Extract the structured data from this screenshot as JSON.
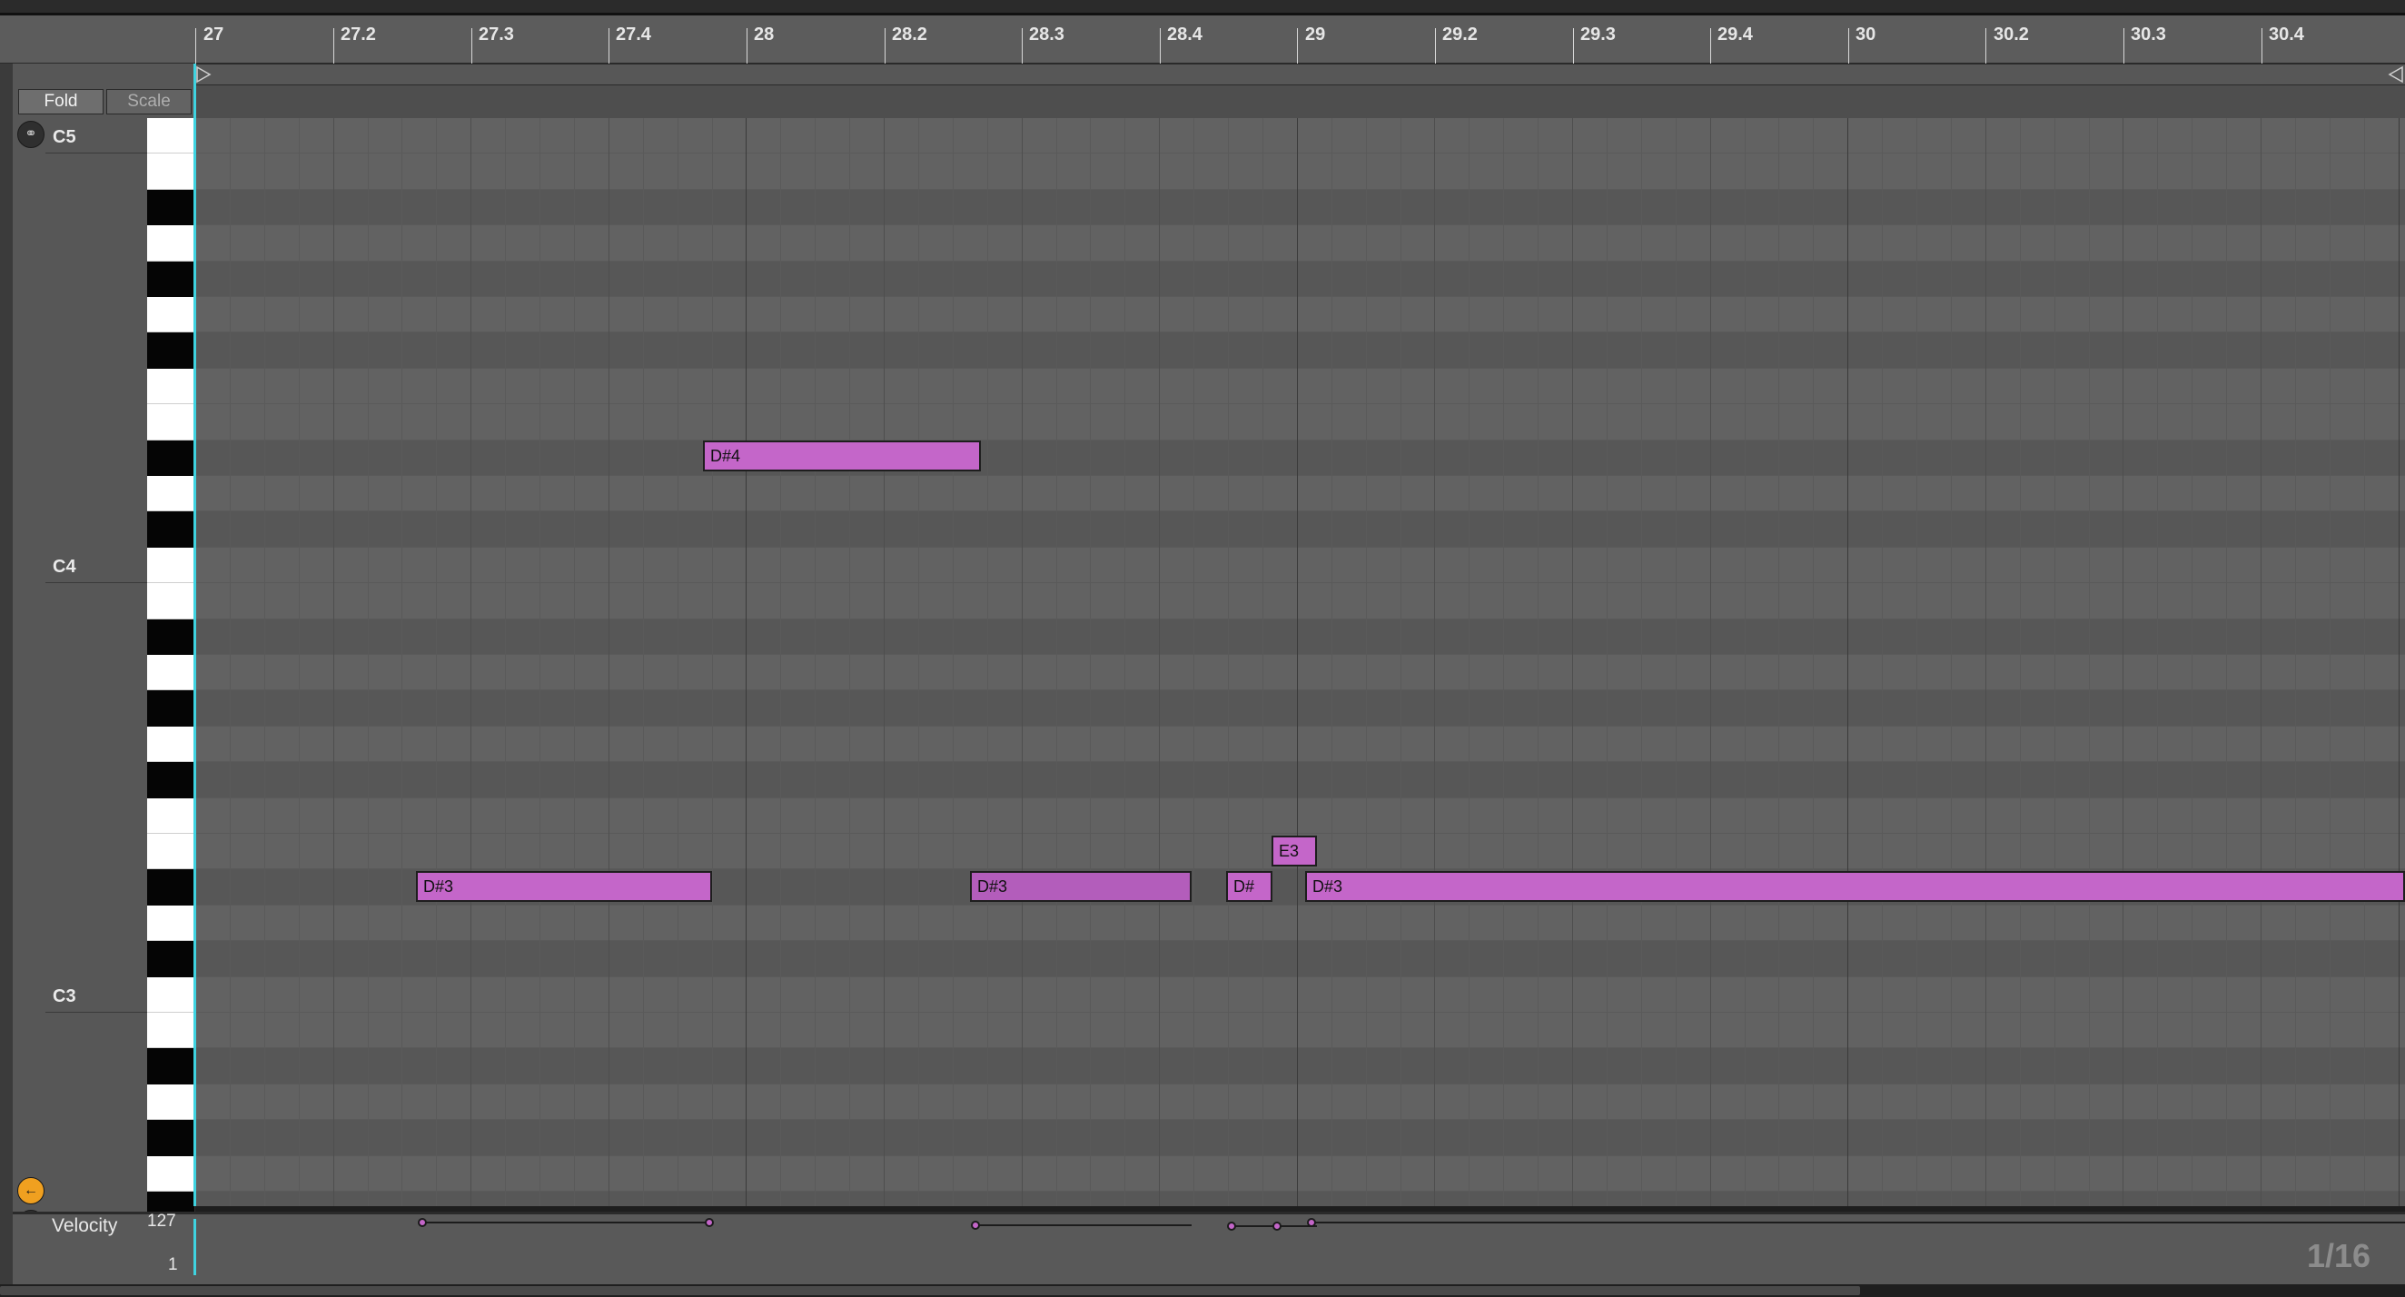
{
  "ruler": {
    "bars": [
      "27",
      "27.2",
      "27.3",
      "27.4",
      "28",
      "28.2",
      "28.3",
      "28.4",
      "29",
      "29.2",
      "29.3",
      "29.4",
      "30",
      "30.2",
      "30.3",
      "30.4"
    ]
  },
  "controls": {
    "fold_label": "Fold",
    "scale_label": "Scale"
  },
  "piano": {
    "octave_labels": [
      "C5",
      "C4",
      "C3"
    ]
  },
  "notes": [
    {
      "label": "D#4"
    },
    {
      "label": "D#3"
    },
    {
      "label": "D#3"
    },
    {
      "label": "D#"
    },
    {
      "label": "E3"
    },
    {
      "label": "D#3"
    }
  ],
  "velocity": {
    "lane_label": "Velocity",
    "max_label": "127",
    "min_label": "1",
    "values": [
      127,
      127,
      120,
      118,
      118,
      127
    ]
  },
  "grid_size": "1/16",
  "colors": {
    "note_fill": "#c466c9",
    "playhead": "#3fd3e0",
    "grid_background": "#626262"
  },
  "icons": {
    "headphones": "headphones-icon",
    "back": "arrow-back-icon",
    "velocity_toggle": "lane-toggle-icon",
    "play": "play-icon"
  }
}
